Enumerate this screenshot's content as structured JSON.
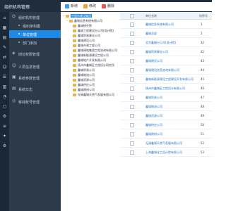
{
  "app": {
    "title": "组织机构管理"
  },
  "rail_icons": [
    "home-icon",
    "grid-icon",
    "table-icon",
    "edit-icon",
    "flow-icon",
    "user-icon",
    "list-icon",
    "report-icon",
    "chart-icon",
    "file-icon",
    "settings-icon",
    "menu-icon",
    "wrench-icon",
    "gear-icon"
  ],
  "nav": {
    "items": [
      {
        "label": "组织机构管理",
        "icon": "org-icon",
        "kind": "group"
      },
      {
        "label": "组织架构图",
        "kind": "sub"
      },
      {
        "label": "单位管理",
        "kind": "sub",
        "active": true
      },
      {
        "label": "部门添加",
        "kind": "sub"
      },
      {
        "label": "岗位权限管理",
        "icon": "role-icon",
        "kind": "group"
      },
      {
        "label": "人员信息管理",
        "icon": "person-icon",
        "kind": "group"
      },
      {
        "label": "系统参数管理",
        "icon": "param-icon",
        "kind": "group"
      },
      {
        "label": "系统日志",
        "icon": "log-icon",
        "kind": "group"
      },
      {
        "label": "移转账号管理",
        "icon": "account-icon",
        "kind": "group"
      }
    ]
  },
  "toolbar": {
    "new_label": "新增",
    "edit_label": "修改",
    "delete_label": "删除"
  },
  "tree": {
    "nodes": [
      {
        "label": "中国市建设集团",
        "depth": 0,
        "selected": true
      },
      {
        "label": "鑫城信息系统有限公司",
        "depth": 1
      },
      {
        "label": "鑫城研究院",
        "depth": 2
      },
      {
        "label": "鑫城工程建设分公司(设计院)",
        "depth": 2
      },
      {
        "label": "鑫城贸易事业公司",
        "depth": 2
      },
      {
        "label": "鑫城建设公司",
        "depth": 2
      },
      {
        "label": "鑫城市政工程公司",
        "depth": 2
      },
      {
        "label": "鑫城建筑集团工程咨询有限公司",
        "depth": 2
      },
      {
        "label": "鑫城新能源建设工程公司",
        "depth": 2
      },
      {
        "label": "鑫城地产开发有限公司",
        "depth": 2
      },
      {
        "label": "扬州市鑫城区工程设计研究所",
        "depth": 2
      },
      {
        "label": "鑫城贸易公司",
        "depth": 2
      },
      {
        "label": "鑫城物流公司",
        "depth": 2
      },
      {
        "label": "鑫城资源公司",
        "depth": 2
      },
      {
        "label": "鑫城供应公司",
        "depth": 2
      },
      {
        "label": "鑫城建材公司",
        "depth": 2
      },
      {
        "label": "无锡鑫城天然气发展有限公司",
        "depth": 2
      }
    ]
  },
  "grid": {
    "columns": [
      "单位名称",
      "排序号"
    ],
    "rows": [
      {
        "name": "鑫城信息系统有限公司",
        "code": "1"
      },
      {
        "name": "鑫城总部",
        "code": "2"
      },
      {
        "name": "北京鑫城分公司(设计院)",
        "code": "32"
      },
      {
        "name": "鑫城贸易事业公司",
        "code": "42"
      },
      {
        "name": "鑫城建设公司",
        "code": "43"
      },
      {
        "name": "鑫城建设信息咨询有限公司",
        "code": "44"
      },
      {
        "name": "鑫城新能源建设工程建设开发有限公司",
        "code": "45"
      },
      {
        "name": "扬州市鑫城区工程设计有限公司",
        "code": "46"
      },
      {
        "name": "鑫城贸易公司",
        "code": "47"
      },
      {
        "name": "鑫城物流公司",
        "code": "48"
      },
      {
        "name": "鑫城资源公司",
        "code": "49"
      },
      {
        "name": "鑫城供应公司",
        "code": "50"
      },
      {
        "name": "鑫城建材公司",
        "code": "51"
      },
      {
        "name": "无锡鑫城天然气发展有限公司",
        "code": "52"
      },
      {
        "name": "上海鑫城化工设计院有限公司",
        "code": "53"
      }
    ]
  },
  "colors": {
    "accent": "#1e88e5",
    "nav_bg": "#2c3a4a",
    "topbar_bg": "#1f2d3d"
  }
}
